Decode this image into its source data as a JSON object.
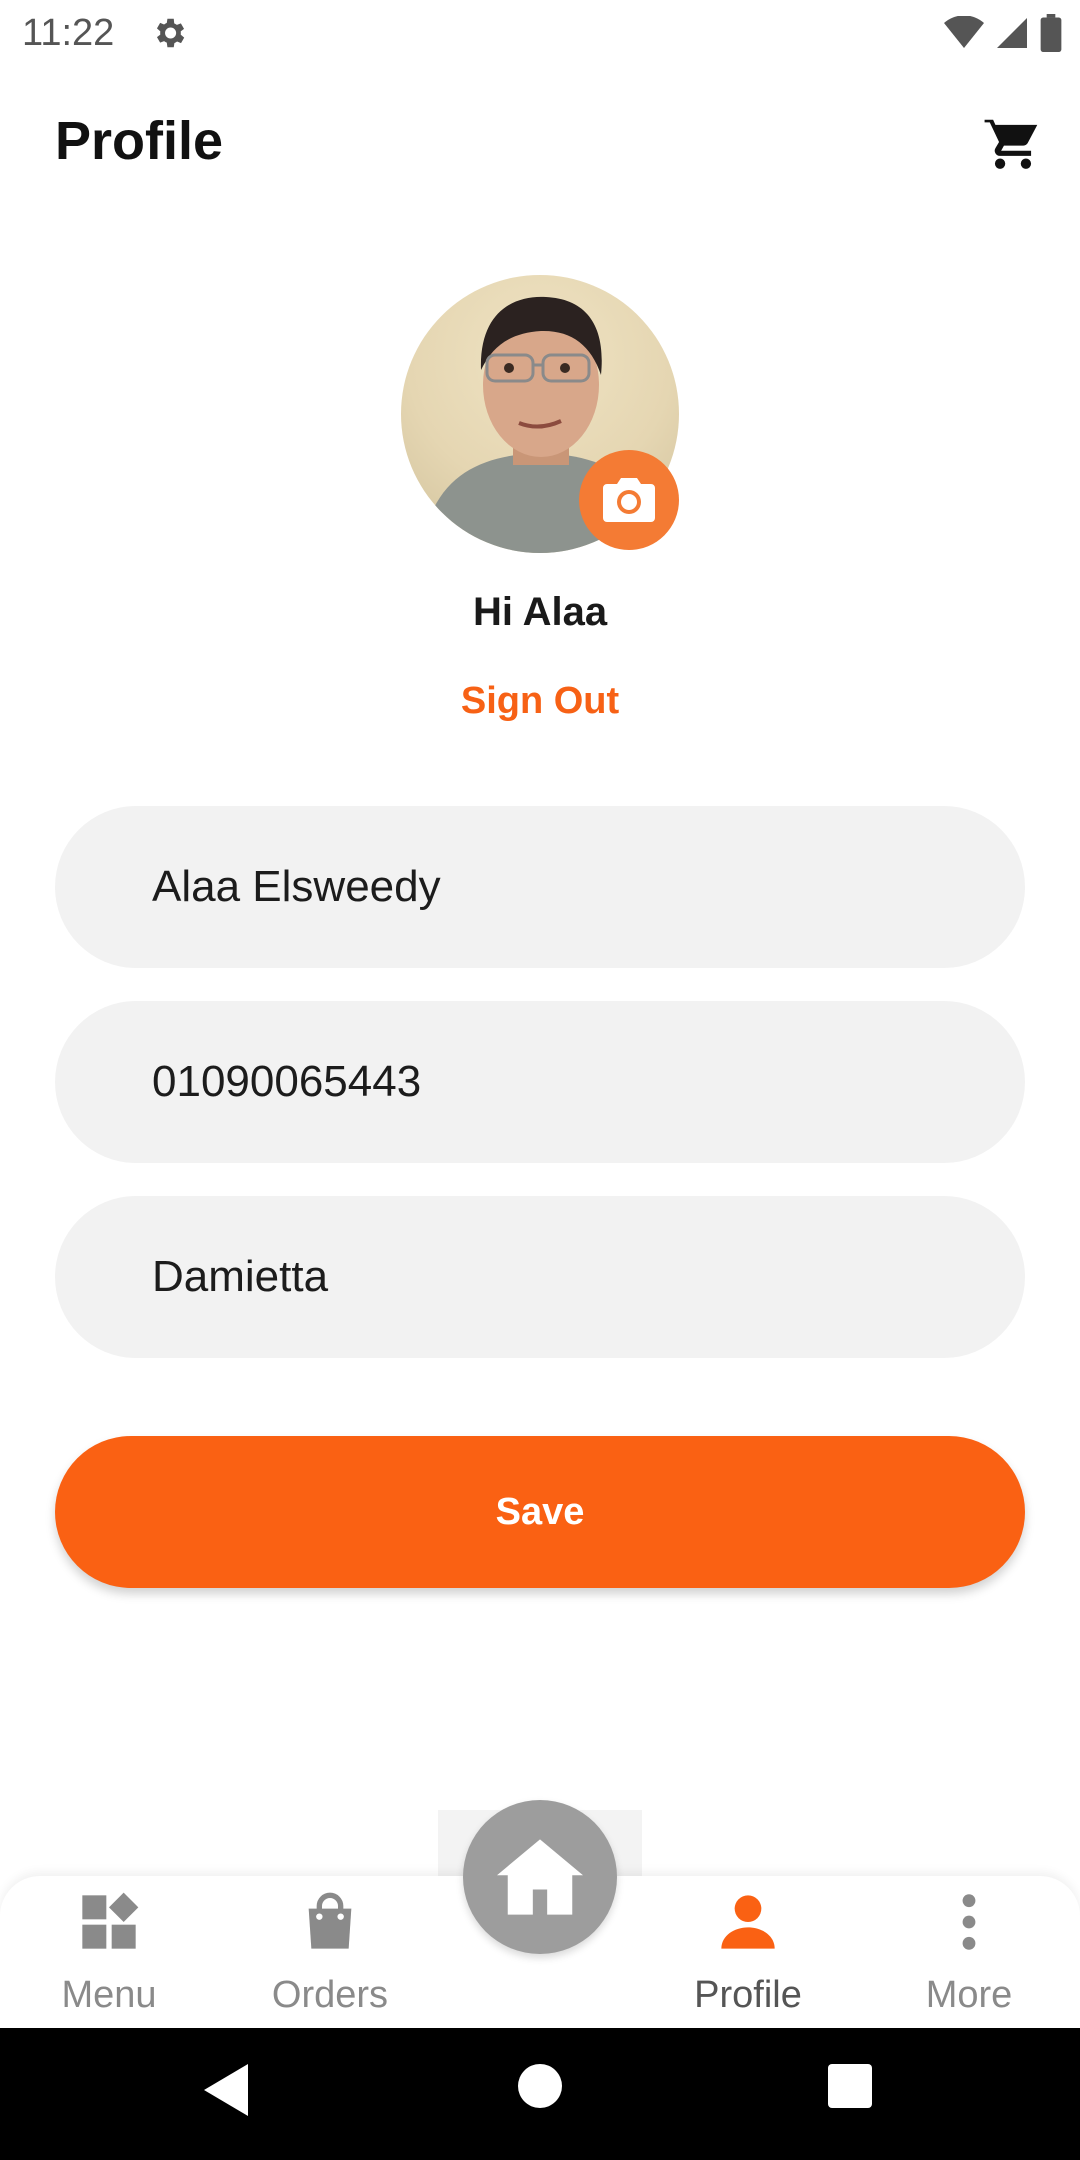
{
  "status_bar": {
    "time": "11:22",
    "icons": [
      "settings-icon",
      "wifi-icon",
      "cell-signal-icon",
      "battery-icon"
    ]
  },
  "app_bar": {
    "title": "Profile",
    "cart_icon": "cart-icon"
  },
  "profile": {
    "greeting": "Hi Alaa",
    "sign_out_label": "Sign Out",
    "camera_icon": "camera-icon"
  },
  "form": {
    "name_value": "Alaa Elsweedy",
    "phone_value": "01090065443",
    "city_value": "Damietta",
    "save_label": "Save"
  },
  "bottom_nav": {
    "items": [
      {
        "label": "Menu",
        "icon": "menu-grid-icon",
        "active": false
      },
      {
        "label": "Orders",
        "icon": "shopping-bag-icon",
        "active": false
      },
      {
        "label": "Profile",
        "icon": "person-icon",
        "active": true
      },
      {
        "label": "More",
        "icon": "more-vertical-icon",
        "active": false
      }
    ],
    "home_icon": "home-icon"
  },
  "colors": {
    "accent": "#fa6113",
    "camera_badge": "#f47b34",
    "field_bg": "#f2f2f2",
    "fab": "#9d9d9d",
    "inactive": "#8a8a8a"
  }
}
